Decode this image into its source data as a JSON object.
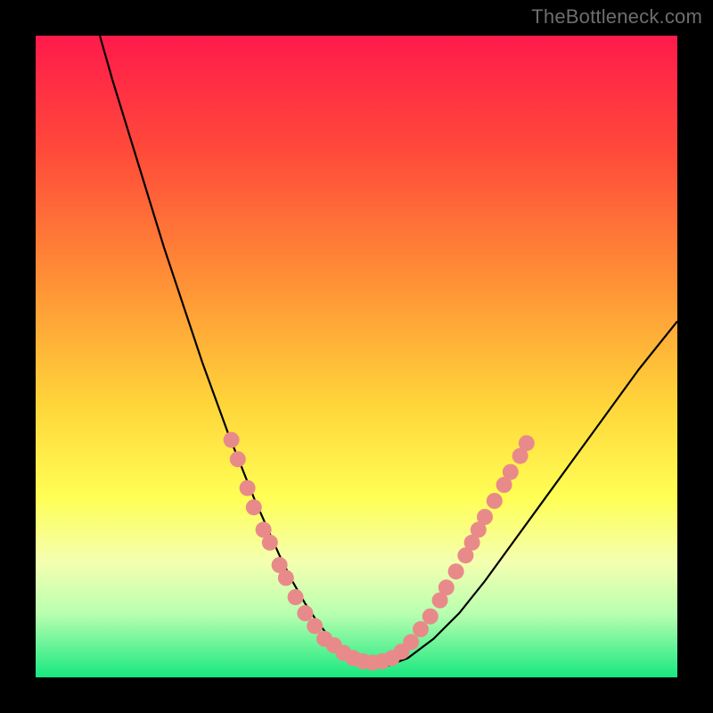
{
  "watermark": "TheBottleneck.com",
  "chart_data": {
    "type": "line",
    "title": "",
    "xlabel": "",
    "ylabel": "",
    "xlim": [
      0,
      100
    ],
    "ylim": [
      0,
      100
    ],
    "gradient_stops": [
      {
        "pct": 0,
        "color": "#ff1a4b"
      },
      {
        "pct": 18,
        "color": "#ff4a3a"
      },
      {
        "pct": 38,
        "color": "#ff8f36"
      },
      {
        "pct": 58,
        "color": "#ffd73a"
      },
      {
        "pct": 72,
        "color": "#ffff55"
      },
      {
        "pct": 82,
        "color": "#f4ffb0"
      },
      {
        "pct": 90,
        "color": "#baffb0"
      },
      {
        "pct": 100,
        "color": "#17e880"
      }
    ],
    "series": [
      {
        "name": "bottleneck-curve",
        "color": "#000000",
        "width": 2.2,
        "x": [
          10,
          12,
          14,
          16,
          18,
          20,
          22,
          24,
          26,
          28,
          30,
          32,
          34,
          36,
          38,
          40,
          42,
          44,
          46,
          50,
          54,
          58,
          62,
          66,
          70,
          74,
          78,
          82,
          86,
          90,
          94,
          98,
          100
        ],
        "y": [
          100,
          93,
          86.5,
          80,
          73.5,
          67,
          61,
          55,
          49,
          43.5,
          38,
          33,
          28,
          23.5,
          19,
          15,
          11.5,
          8.5,
          6,
          3,
          1.5,
          3,
          6,
          10,
          15,
          20.5,
          26,
          31.5,
          37,
          42.5,
          48,
          53,
          55.5
        ]
      }
    ],
    "markers": {
      "name": "highlight-dots",
      "color": "#e98a8a",
      "radius": 9,
      "points": [
        {
          "x": 30.5,
          "y": 37
        },
        {
          "x": 31.5,
          "y": 34
        },
        {
          "x": 33.0,
          "y": 29.5
        },
        {
          "x": 34.0,
          "y": 26.5
        },
        {
          "x": 35.5,
          "y": 23
        },
        {
          "x": 36.5,
          "y": 21
        },
        {
          "x": 38.0,
          "y": 17.5
        },
        {
          "x": 39.0,
          "y": 15.5
        },
        {
          "x": 40.5,
          "y": 12.5
        },
        {
          "x": 42.0,
          "y": 10
        },
        {
          "x": 43.5,
          "y": 8
        },
        {
          "x": 45.0,
          "y": 6
        },
        {
          "x": 46.5,
          "y": 5
        },
        {
          "x": 48.0,
          "y": 3.8
        },
        {
          "x": 49.5,
          "y": 3
        },
        {
          "x": 51.0,
          "y": 2.5
        },
        {
          "x": 52.5,
          "y": 2.3
        },
        {
          "x": 54.0,
          "y": 2.5
        },
        {
          "x": 55.5,
          "y": 3
        },
        {
          "x": 57.0,
          "y": 4
        },
        {
          "x": 58.5,
          "y": 5.5
        },
        {
          "x": 60.0,
          "y": 7.5
        },
        {
          "x": 61.5,
          "y": 9.5
        },
        {
          "x": 63.0,
          "y": 12
        },
        {
          "x": 64.0,
          "y": 14
        },
        {
          "x": 65.5,
          "y": 16.5
        },
        {
          "x": 67.0,
          "y": 19
        },
        {
          "x": 68.0,
          "y": 21
        },
        {
          "x": 69.0,
          "y": 23
        },
        {
          "x": 70.0,
          "y": 25
        },
        {
          "x": 71.5,
          "y": 27.5
        },
        {
          "x": 73.0,
          "y": 30
        },
        {
          "x": 74.0,
          "y": 32
        },
        {
          "x": 75.5,
          "y": 34.5
        },
        {
          "x": 76.5,
          "y": 36.5
        }
      ]
    }
  }
}
